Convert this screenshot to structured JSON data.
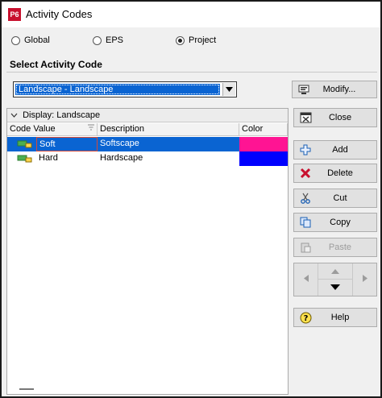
{
  "window": {
    "app_badge": "P6",
    "title": "Activity Codes"
  },
  "scope": {
    "options": [
      {
        "label": "Global",
        "selected": false
      },
      {
        "label": "EPS",
        "selected": false
      },
      {
        "label": "Project",
        "selected": true
      }
    ]
  },
  "select_section": {
    "heading": "Select Activity Code",
    "selected_code": "Landscape - Landscape",
    "modify_label": "Modify..."
  },
  "grid": {
    "display_label": "Display: Landscape",
    "columns": [
      "Code Value",
      "Description",
      "Color"
    ],
    "rows": [
      {
        "code_value": "Soft",
        "description": "Softscape",
        "color": "#ff1493",
        "selected": true
      },
      {
        "code_value": "Hard",
        "description": "Hardscape",
        "color": "#0000ff",
        "selected": false
      }
    ]
  },
  "actions": {
    "close": "Close",
    "add": "Add",
    "delete": "Delete",
    "cut": "Cut",
    "copy": "Copy",
    "paste": "Paste",
    "help": "Help"
  },
  "colors": {
    "selection": "#0a64d2",
    "delete_icon": "#c8102e"
  }
}
